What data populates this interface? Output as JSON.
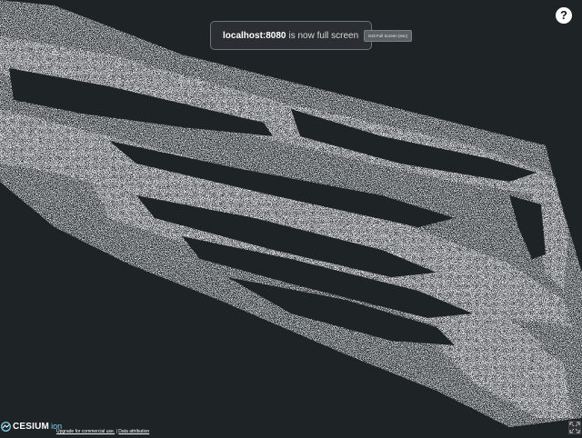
{
  "banner": {
    "host": "localhost:8080",
    "message": "is now full screen",
    "exit_label": "Exit Full Screen (esc)"
  },
  "help": {
    "label": "?"
  },
  "logo": {
    "cesium": "CESIUM",
    "ion": "ion"
  },
  "credits": {
    "upgrade": "Upgrade for commercial use.",
    "separator": "|",
    "attribution": "Data attribution"
  },
  "icons": {
    "lock": "lock-icon",
    "fullscreen": "fullscreen-icon",
    "ion_mark": "ion-mark-icon"
  },
  "colors": {
    "background": "#1e2326",
    "points": "#cfd2d4",
    "ion_accent": "#7fd3f2"
  }
}
